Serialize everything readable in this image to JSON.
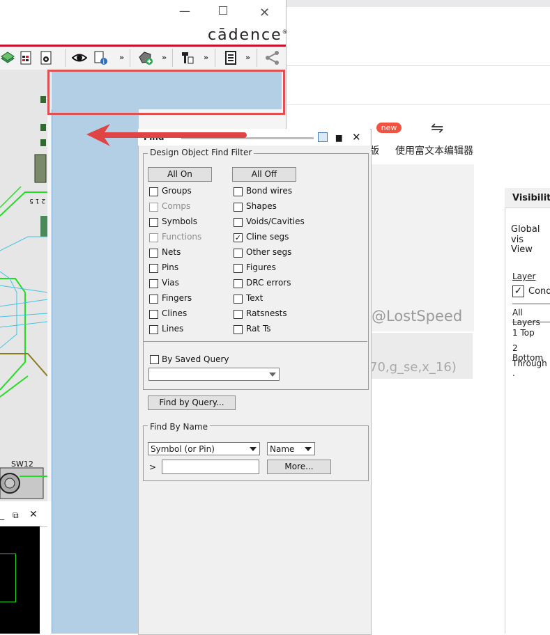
{
  "background": {
    "new_badge": "new",
    "toolbar_label": "使用富文本编辑器",
    "toolbar_label_left": "版",
    "watermark": "@LostSpeed",
    "code_fragment": "70,g_se,x_16)"
  },
  "visibility": {
    "title": "Visibility",
    "global": "Global vis",
    "view": "View",
    "layer": "Layer",
    "cond": "Cond",
    "all_layers": "All Layers",
    "layers": [
      "1 Top",
      "2 Bottom",
      "Through ."
    ]
  },
  "cadence": {
    "logo": "cādence",
    "registered": "®",
    "pcb_labels": [
      "2 1 5",
      "SW12"
    ]
  },
  "find": {
    "title": "Find",
    "filter_legend": "Design Object Find Filter",
    "all_on": "All On",
    "all_off": "All Off",
    "left_items": [
      {
        "label": "Groups",
        "checked": false,
        "disabled": false
      },
      {
        "label": "Comps",
        "checked": false,
        "disabled": true
      },
      {
        "label": "Symbols",
        "checked": false,
        "disabled": false
      },
      {
        "label": "Functions",
        "checked": false,
        "disabled": true
      },
      {
        "label": "Nets",
        "checked": false,
        "disabled": false
      },
      {
        "label": "Pins",
        "checked": false,
        "disabled": false
      },
      {
        "label": "Vias",
        "checked": false,
        "disabled": false
      },
      {
        "label": "Fingers",
        "checked": false,
        "disabled": false
      },
      {
        "label": "Clines",
        "checked": false,
        "disabled": false
      },
      {
        "label": "Lines",
        "checked": false,
        "disabled": false
      }
    ],
    "right_items": [
      {
        "label": "Bond wires",
        "checked": false
      },
      {
        "label": "Shapes",
        "checked": false
      },
      {
        "label": "Voids/Cavities",
        "checked": false
      },
      {
        "label": "Cline segs",
        "checked": true
      },
      {
        "label": "Other segs",
        "checked": false
      },
      {
        "label": "Figures",
        "checked": false
      },
      {
        "label": "DRC errors",
        "checked": false
      },
      {
        "label": "Text",
        "checked": false
      },
      {
        "label": "Ratsnests",
        "checked": false
      },
      {
        "label": "Rat Ts",
        "checked": false
      }
    ],
    "saved_query": "By Saved Query",
    "saved_query_value": "",
    "find_by_query": "Find by Query...",
    "name_legend": "Find By Name",
    "type_value": "Symbol (or Pin)",
    "mode_value": "Name",
    "prompt": ">",
    "name_value": "",
    "more": "More...",
    "checkmark": "✓"
  },
  "colors": {
    "accent_red": "#c8102e",
    "drop_highlight": "#e05050",
    "dock_blue": "#b3cfe6",
    "new_badge": "#f0533f"
  }
}
